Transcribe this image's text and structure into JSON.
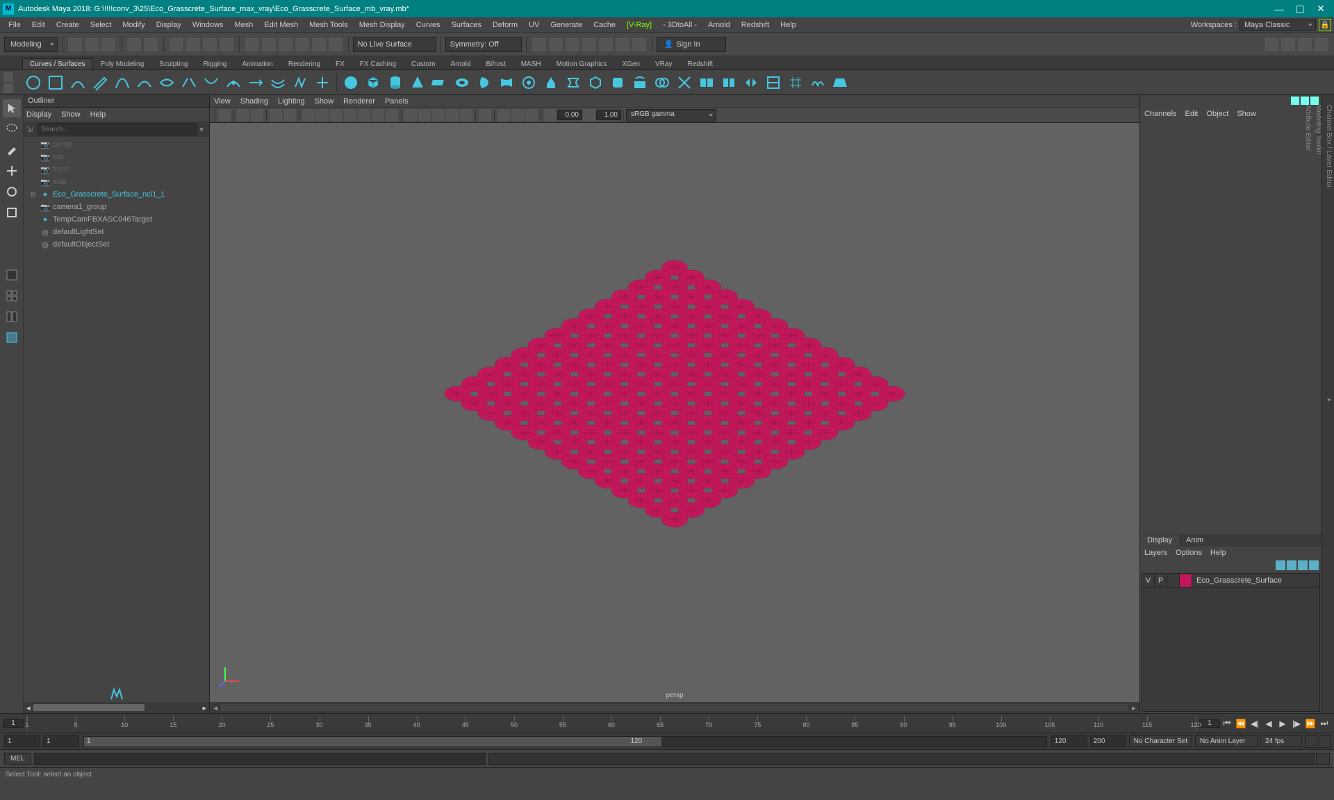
{
  "title": "Autodesk Maya 2018: G:\\!!!!conv_3\\25\\Eco_Grasscrete_Surface_max_vray\\Eco_Grasscrete_Surface_mb_vray.mb*",
  "menus": [
    "File",
    "Edit",
    "Create",
    "Select",
    "Modify",
    "Display",
    "Windows",
    "Mesh",
    "Edit Mesh",
    "Mesh Tools",
    "Mesh Display",
    "Curves",
    "Surfaces",
    "Deform",
    "UV",
    "Generate",
    "Cache"
  ],
  "menus2": [
    "[V-Ray]",
    "- 3DtoAll -",
    "Arnold",
    "Redshift",
    "Help"
  ],
  "workspace_label": "Workspaces :",
  "workspace_value": "Maya Classic",
  "mode": "Modeling",
  "no_live": "No Live Surface",
  "symmetry": "Symmetry: Off",
  "signin": "Sign In",
  "shelf_tabs": [
    "Curves / Surfaces",
    "Poly Modeling",
    "Sculpting",
    "Rigging",
    "Animation",
    "Rendering",
    "FX",
    "FX Caching",
    "Custom",
    "Arnold",
    "Bifrost",
    "MASH",
    "Motion Graphics",
    "XGen",
    "VRay",
    "Redshift"
  ],
  "outliner": {
    "title": "Outliner",
    "menus": [
      "Display",
      "Show",
      "Help"
    ],
    "search_placeholder": "Search...",
    "nodes": [
      {
        "label": "persp",
        "dim": true,
        "icon": "cam"
      },
      {
        "label": "top",
        "dim": true,
        "icon": "cam"
      },
      {
        "label": "front",
        "dim": true,
        "icon": "cam"
      },
      {
        "label": "side",
        "dim": true,
        "icon": "cam"
      },
      {
        "label": "Eco_Grasscrete_Surface_ncl1_1",
        "dim": false,
        "icon": "xform",
        "exp": "[+]",
        "hi": true
      },
      {
        "label": "camera1_group",
        "dim": false,
        "icon": "cam"
      },
      {
        "label": "TempCamFBXASC046Target",
        "dim": false,
        "icon": "xform",
        "hi": true
      },
      {
        "label": "defaultLightSet",
        "dim": false,
        "icon": "set"
      },
      {
        "label": "defaultObjectSet",
        "dim": false,
        "icon": "set"
      }
    ]
  },
  "viewport": {
    "menus": [
      "View",
      "Shading",
      "Lighting",
      "Show",
      "Renderer",
      "Panels"
    ],
    "num1": "0.00",
    "num2": "1.00",
    "gamma": "sRGB gamma",
    "camera": "persp"
  },
  "channelbox": {
    "tabs": [
      "Channels",
      "Edit",
      "Object",
      "Show"
    ]
  },
  "layerpanel": {
    "tabs": [
      "Display",
      "Anim"
    ],
    "menus": [
      "Layers",
      "Options",
      "Help"
    ],
    "row": {
      "v": "V",
      "p": "P",
      "name": "Eco_Grasscrete_Surface"
    }
  },
  "right_tabs": [
    "Channel Box / Layer Editor",
    "Modeling Toolkit",
    "Attribute Editor"
  ],
  "timeline": {
    "current": "1",
    "ticks": [
      "1",
      "5",
      "10",
      "15",
      "20",
      "25",
      "30",
      "35",
      "40",
      "45",
      "50",
      "55",
      "60",
      "65",
      "70",
      "75",
      "80",
      "85",
      "90",
      "95",
      "100",
      "105",
      "110",
      "115",
      "120"
    ]
  },
  "range": {
    "start": "1",
    "startvis": "1",
    "end": "120",
    "endv": "120",
    "e2": "200",
    "charset": "No Character Set",
    "animlayer": "No Anim Layer",
    "fps": "24 fps"
  },
  "cmd": {
    "lang": "MEL"
  },
  "status_msg": "Select Tool: select an object",
  "colors": {
    "accent": "#46c7e0"
  }
}
